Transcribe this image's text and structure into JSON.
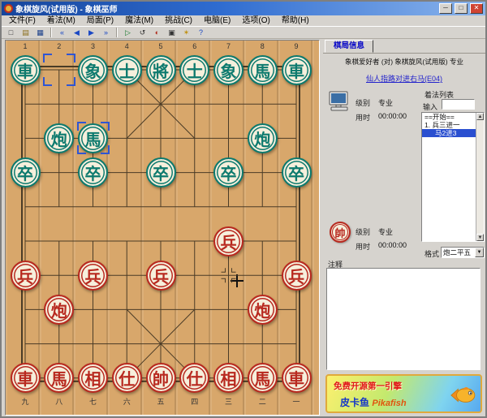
{
  "window": {
    "title": "象棋旋风(试用版) - 象棋巫师",
    "controls": [
      {
        "name": "minimize",
        "glyph": "─"
      },
      {
        "name": "maximize",
        "glyph": "□"
      },
      {
        "name": "close",
        "glyph": "✕"
      }
    ]
  },
  "menu": {
    "items": [
      "文件(F)",
      "着法(M)",
      "局面(P)",
      "魔法(M)",
      "挑战(C)",
      "电脑(E)",
      "选项(O)",
      "帮助(H)"
    ]
  },
  "toolbar": {
    "buttons": [
      {
        "name": "new",
        "glyph": "□",
        "color": "#333333"
      },
      {
        "name": "open",
        "glyph": "▤",
        "color": "#8a6d1a"
      },
      {
        "name": "save",
        "glyph": "▦",
        "color": "#1a3f8a"
      },
      {
        "name": "separator"
      },
      {
        "name": "first-move",
        "glyph": "«",
        "color": "#1a48c4"
      },
      {
        "name": "prev-move",
        "glyph": "◀",
        "color": "#1a48c4"
      },
      {
        "name": "next-move",
        "glyph": "▶",
        "color": "#1a48c4"
      },
      {
        "name": "last-move",
        "glyph": "»",
        "color": "#1a48c4"
      },
      {
        "name": "separator"
      },
      {
        "name": "demo",
        "glyph": "▷",
        "color": "#167a2e"
      },
      {
        "name": "flip-board",
        "glyph": "↺",
        "color": "#333333"
      },
      {
        "name": "swap-sides",
        "glyph": "◐",
        "color": "#b02a1a"
      },
      {
        "name": "computer-play",
        "glyph": "▣",
        "color": "#333333"
      },
      {
        "name": "hint",
        "glyph": "✶",
        "color": "#c09010"
      },
      {
        "name": "help",
        "glyph": "?",
        "color": "#1a48c4"
      }
    ]
  },
  "board": {
    "columns_top": [
      "1",
      "2",
      "3",
      "4",
      "5",
      "6",
      "7",
      "8",
      "9"
    ],
    "columns_bottom": [
      "九",
      "八",
      "七",
      "六",
      "五",
      "四",
      "三",
      "二",
      "一"
    ],
    "colors": {
      "black_piece": "#0d7a6e",
      "red_piece": "#b8291f",
      "line": "#4a3b26",
      "bracket": "#2f55d4"
    },
    "last_move": {
      "from": {
        "col": 2,
        "row": 1
      },
      "to": {
        "col": 3,
        "row": 3
      }
    },
    "pieces": [
      {
        "side": "black",
        "ch": "車",
        "col": 1,
        "row": 1
      },
      {
        "side": "black",
        "ch": "象",
        "col": 3,
        "row": 1
      },
      {
        "side": "black",
        "ch": "士",
        "col": 4,
        "row": 1
      },
      {
        "side": "black",
        "ch": "將",
        "col": 5,
        "row": 1
      },
      {
        "side": "black",
        "ch": "士",
        "col": 6,
        "row": 1
      },
      {
        "side": "black",
        "ch": "象",
        "col": 7,
        "row": 1
      },
      {
        "side": "black",
        "ch": "馬",
        "col": 8,
        "row": 1
      },
      {
        "side": "black",
        "ch": "車",
        "col": 9,
        "row": 1
      },
      {
        "side": "black",
        "ch": "炮",
        "col": 2,
        "row": 3
      },
      {
        "side": "black",
        "ch": "馬",
        "col": 3,
        "row": 3
      },
      {
        "side": "black",
        "ch": "炮",
        "col": 8,
        "row": 3
      },
      {
        "side": "black",
        "ch": "卒",
        "col": 1,
        "row": 4
      },
      {
        "side": "black",
        "ch": "卒",
        "col": 3,
        "row": 4
      },
      {
        "side": "black",
        "ch": "卒",
        "col": 5,
        "row": 4
      },
      {
        "side": "black",
        "ch": "卒",
        "col": 7,
        "row": 4
      },
      {
        "side": "black",
        "ch": "卒",
        "col": 9,
        "row": 4
      },
      {
        "side": "red",
        "ch": "兵",
        "col": 7,
        "row": 6
      },
      {
        "side": "red",
        "ch": "兵",
        "col": 1,
        "row": 7
      },
      {
        "side": "red",
        "ch": "兵",
        "col": 3,
        "row": 7
      },
      {
        "side": "red",
        "ch": "兵",
        "col": 5,
        "row": 7
      },
      {
        "side": "red",
        "ch": "兵",
        "col": 9,
        "row": 7
      },
      {
        "side": "red",
        "ch": "炮",
        "col": 2,
        "row": 8
      },
      {
        "side": "red",
        "ch": "炮",
        "col": 8,
        "row": 8
      },
      {
        "side": "red",
        "ch": "車",
        "col": 1,
        "row": 10
      },
      {
        "side": "red",
        "ch": "馬",
        "col": 2,
        "row": 10
      },
      {
        "side": "red",
        "ch": "相",
        "col": 3,
        "row": 10
      },
      {
        "side": "red",
        "ch": "仕",
        "col": 4,
        "row": 10
      },
      {
        "side": "red",
        "ch": "帥",
        "col": 5,
        "row": 10
      },
      {
        "side": "red",
        "ch": "仕",
        "col": 6,
        "row": 10
      },
      {
        "side": "red",
        "ch": "相",
        "col": 7,
        "row": 10
      },
      {
        "side": "red",
        "ch": "馬",
        "col": 8,
        "row": 10
      },
      {
        "side": "red",
        "ch": "車",
        "col": 9,
        "row": 10
      }
    ]
  },
  "side_panel": {
    "tab": "棋局信息",
    "match_title": "象棋爱好者 (对) 象棋旋风(试用版) 专业",
    "opening_link": "仙人指路对进右马(E04)",
    "black_player": {
      "level_label": "级别",
      "level": "专业",
      "time_label": "用时",
      "time": "00:00:00"
    },
    "red_player": {
      "piece_char": "帥",
      "level_label": "级别",
      "level": "专业",
      "time_label": "用时",
      "time": "00:00:00"
    },
    "move_list": {
      "title": "着法列表",
      "input_label": "输入",
      "input_value": "",
      "items": [
        "==开始==",
        "1. 兵三进一",
        "马2进3"
      ],
      "selected_index": 2
    },
    "format": {
      "label": "格式",
      "value": "炮二平五"
    },
    "notes_label": "注释",
    "notes_value": "",
    "banner": {
      "line1": "免费开源第一引擎",
      "line2_cn": "皮卡鱼",
      "line2_en": "Pikafish"
    }
  }
}
